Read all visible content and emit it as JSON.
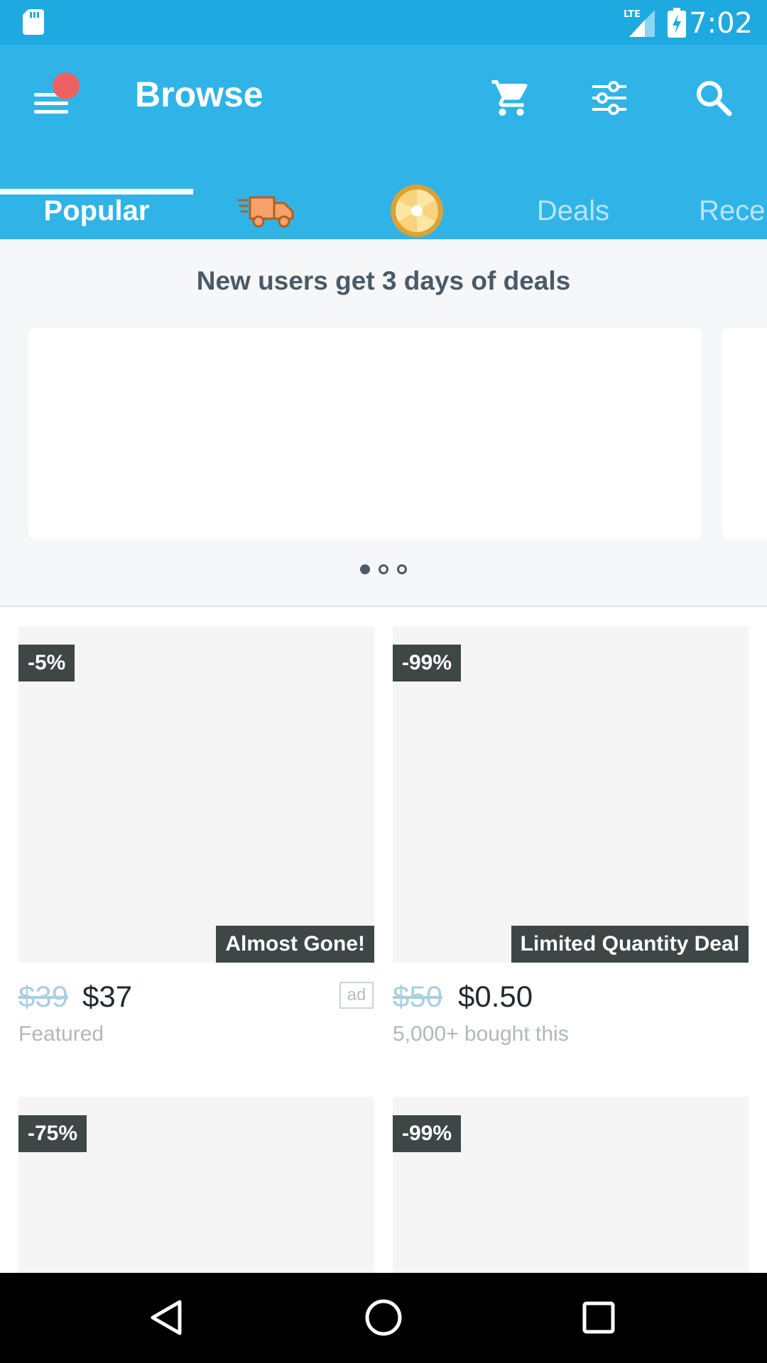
{
  "status_bar": {
    "time": "7:02",
    "network": "LTE"
  },
  "app_bar": {
    "title": "Browse"
  },
  "tabs": [
    {
      "label": "Popular",
      "active": true
    },
    {
      "label": "",
      "icon": "delivery-truck-icon"
    },
    {
      "label": "",
      "icon": "prize-wheel-icon"
    },
    {
      "label": "Deals"
    },
    {
      "label": "Rece"
    }
  ],
  "banner": {
    "title": "New users get 3 days of deals",
    "page_count": 3,
    "current_page": 1
  },
  "products": [
    {
      "discount": "-5%",
      "tag": "Almost Gone!",
      "old_price": "$39",
      "price": "$37",
      "subtitle": "Featured",
      "ad_label": "ad"
    },
    {
      "discount": "-99%",
      "tag": "Limited Quantity Deal",
      "old_price": "$50",
      "price": "$0.50",
      "subtitle": "5,000+ bought this"
    },
    {
      "discount": "-75%"
    },
    {
      "discount": "-99%"
    }
  ],
  "colors": {
    "accent": "#30b4e8",
    "status_bar": "#1ea9e0",
    "badge": "#3e4646",
    "notification": "#ec6262"
  }
}
